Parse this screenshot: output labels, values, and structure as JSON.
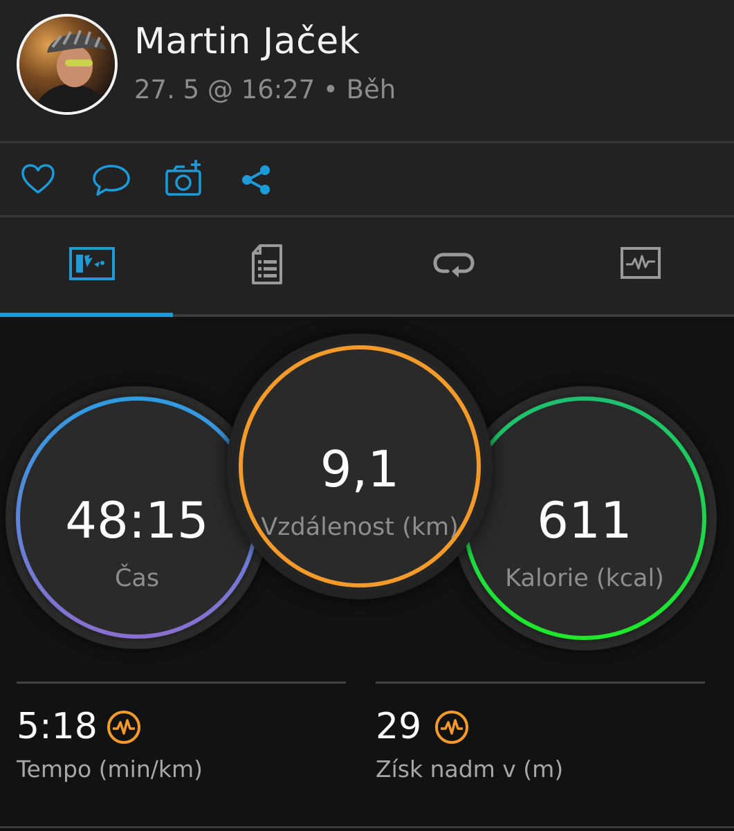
{
  "header": {
    "user_name": "Martin Jaček",
    "meta": "27. 5 @ 16:27 • Běh"
  },
  "actions": [
    {
      "icon": "heart-icon",
      "label": "like"
    },
    {
      "icon": "comment-icon",
      "label": "comment"
    },
    {
      "icon": "add-photo-icon",
      "label": "add photo"
    },
    {
      "icon": "share-icon",
      "label": "share"
    }
  ],
  "tabs": [
    {
      "icon": "overview-icon",
      "active": true
    },
    {
      "icon": "details-list-icon",
      "active": false
    },
    {
      "icon": "laps-icon",
      "active": false
    },
    {
      "icon": "charts-icon",
      "active": false
    }
  ],
  "rings": {
    "time": {
      "value": "48:15",
      "label": "Čas"
    },
    "distance": {
      "value": "9,1",
      "label": "Vzdálenost (km)"
    },
    "calories": {
      "value": "611",
      "label": "Kalorie (kcal)"
    }
  },
  "stats": {
    "pace": {
      "value": "5:18",
      "label": "Tempo (min/km)",
      "icon": "pulse-icon"
    },
    "elevation": {
      "value": "29",
      "label": "Získ nadm v (m)",
      "icon": "pulse-icon"
    }
  },
  "colors": {
    "accent": "#1d9bd8",
    "time_ring_start": "#2f9be0",
    "time_ring_end": "#8a6fd0",
    "distance_ring": "#f39a2a",
    "calories_ring_start": "#1fbf70",
    "calories_ring_end": "#1ee92a",
    "stat_icon": "#f39a2a"
  }
}
